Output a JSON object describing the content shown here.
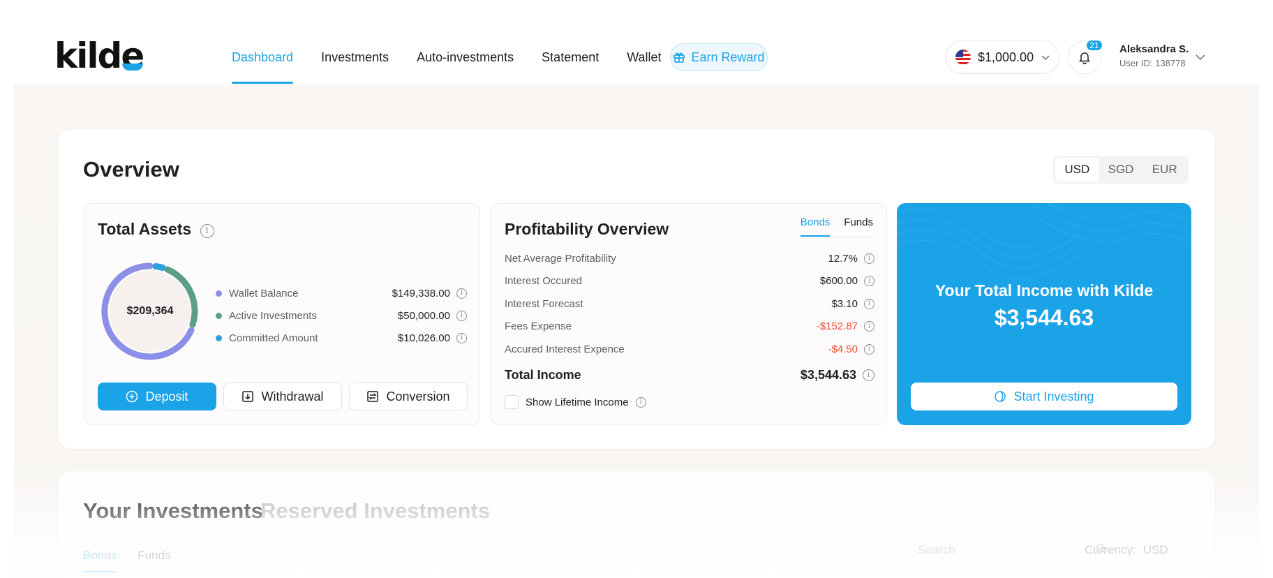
{
  "header": {
    "logo": "kilde",
    "nav": [
      {
        "label": "Dashboard",
        "active": true
      },
      {
        "label": "Investments"
      },
      {
        "label": "Auto-investments"
      },
      {
        "label": "Statement"
      },
      {
        "label": "Wallet"
      }
    ],
    "earn_reward": "Earn Reward",
    "balance": "$1,000.00",
    "notifications_count": "21",
    "user_name": "Aleksandra S.",
    "user_id": "User ID: 138778"
  },
  "overview": {
    "title": "Overview",
    "currencies": [
      "USD",
      "SGD",
      "EUR"
    ],
    "active_currency": "USD",
    "total_assets": {
      "title": "Total Assets",
      "total": "$209,364",
      "items": [
        {
          "label": "Wallet Balance",
          "value": "$149,338.00",
          "color": "#8b8fe8"
        },
        {
          "label": "Active Investments",
          "value": "$50,000.00",
          "color": "#5b9e8a"
        },
        {
          "label": "Committed Amount",
          "value": "$10,026.00",
          "color": "#2f9fdd"
        }
      ],
      "buttons": {
        "deposit": "Deposit",
        "withdrawal": "Withdrawal",
        "conversion": "Conversion"
      }
    },
    "profitability": {
      "title": "Profitability Overview",
      "tabs": [
        "Bonds",
        "Funds"
      ],
      "rows": [
        {
          "label": "Net Average Profitability",
          "value": "12.7%"
        },
        {
          "label": "Interest Occured",
          "value": "$600.00"
        },
        {
          "label": "Interest Forecast",
          "value": "$3.10"
        },
        {
          "label": "Fees Expense",
          "value": "-$152.87"
        },
        {
          "label": "Accured Interest Expence",
          "value": "-$4.50"
        }
      ],
      "total_label": "Total Income",
      "total_value": "$3,544.63",
      "lifetime_label": "Show Lifetime Income"
    },
    "income": {
      "title": "Your Total Income with Kilde",
      "value": "$3,544.63",
      "button": "Start Investing"
    }
  },
  "investments": {
    "title": "Your Investments",
    "title_secondary": "Reserved Investments",
    "tabs": [
      "Bonds",
      "Funds"
    ],
    "search_placeholder": "Search",
    "currency_label": "Currency:",
    "currency_value": "USD"
  },
  "colors": {
    "accent": "#1ba3e8",
    "negative": "#ef4f34"
  }
}
